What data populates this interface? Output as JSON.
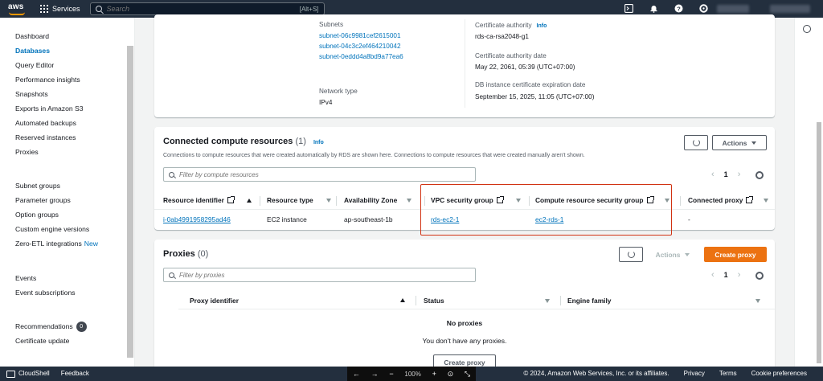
{
  "topnav": {
    "services_label": "Services",
    "search_placeholder": "Search",
    "search_shortcut": "[Alt+S]"
  },
  "sidebar": {
    "group1": [
      "Dashboard",
      "Databases",
      "Query Editor",
      "Performance insights",
      "Snapshots",
      "Exports in Amazon S3",
      "Automated backups",
      "Reserved instances",
      "Proxies"
    ],
    "group2": [
      "Subnet groups",
      "Parameter groups",
      "Option groups",
      "Custom engine versions",
      "Zero-ETL integrations"
    ],
    "new_label": "New",
    "group3": [
      "Events",
      "Event subscriptions"
    ],
    "recommendations": "Recommendations",
    "recommendations_count": "0",
    "certificate_update": "Certificate update",
    "active_item": "Databases"
  },
  "details": {
    "subnets_label": "Subnets",
    "subnets": [
      "subnet-06c9981cef2615001",
      "subnet-04c3c2ef464210042",
      "subnet-0eddd4a8bd9a77ea6"
    ],
    "network_type_label": "Network type",
    "network_type": "IPv4",
    "ca_label": "Certificate authority",
    "info": "Info",
    "ca_value": "rds-ca-rsa2048-g1",
    "ca_date_label": "Certificate authority date",
    "ca_date": "May 22, 2061, 05:39 (UTC+07:00)",
    "expiry_label": "DB instance certificate expiration date",
    "expiry_date": "September 15, 2025, 11:05 (UTC+07:00)"
  },
  "compute": {
    "title": "Connected compute resources",
    "count": "(1)",
    "info": "Info",
    "description": "Connections to compute resources that were created automatically by RDS are shown here. Connections to compute resources that were created manually aren't shown.",
    "actions": "Actions",
    "filter_placeholder": "Filter by compute resources",
    "page": "1",
    "columns": [
      "Resource identifier",
      "Resource type",
      "Availability Zone",
      "VPC security group",
      "Compute resource security group",
      "Connected proxy"
    ],
    "row": [
      "i-0ab4991958295ad46",
      "EC2 instance",
      "ap-southeast-1b",
      "rds-ec2-1",
      "ec2-rds-1",
      "-"
    ]
  },
  "proxies": {
    "title": "Proxies",
    "count": "(0)",
    "actions": "Actions",
    "create": "Create proxy",
    "filter_placeholder": "Filter by proxies",
    "page": "1",
    "columns": [
      "Proxy identifier",
      "Status",
      "Engine family"
    ],
    "empty_title": "No proxies",
    "empty_desc": "You don't have any proxies.",
    "create_secondary": "Create proxy"
  },
  "bottombar": {
    "cloudshell": "CloudShell",
    "feedback": "Feedback",
    "zoom": "100%",
    "copyright": "© 2024, Amazon Web Services, Inc. or its affiliates.",
    "privacy": "Privacy",
    "terms": "Terms",
    "cookies": "Cookie preferences"
  },
  "colors": {
    "nav": "#232f3e",
    "link": "#0073bb",
    "primary": "#ec7211",
    "highlight": "#d13212"
  }
}
